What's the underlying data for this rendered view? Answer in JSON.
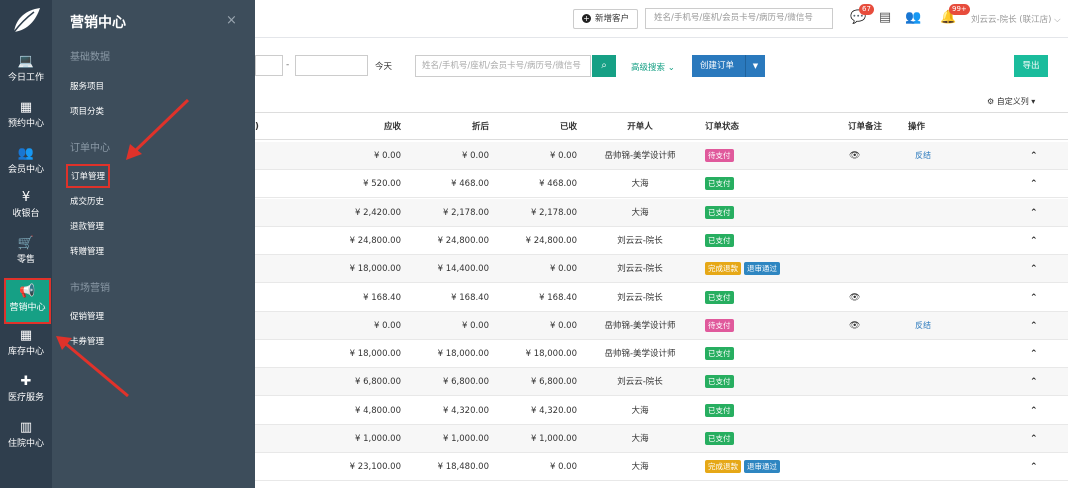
{
  "nav": [
    {
      "id": "today-work",
      "label": "今日工作",
      "icon": "laptop-icon",
      "glyph": "💻"
    },
    {
      "id": "appointment",
      "label": "预约中心",
      "icon": "calendar-icon",
      "glyph": "▦"
    },
    {
      "id": "member",
      "label": "会员中心",
      "icon": "users-icon",
      "glyph": "👥"
    },
    {
      "id": "cashier",
      "label": "收银台",
      "icon": "yen-icon",
      "glyph": "¥"
    },
    {
      "id": "retail",
      "label": "零售",
      "icon": "cart-icon",
      "glyph": "🛒"
    },
    {
      "id": "marketing",
      "label": "营销中心",
      "icon": "megaphone-icon",
      "glyph": "📢"
    },
    {
      "id": "inventory",
      "label": "库存中心",
      "icon": "grid-icon",
      "glyph": "▦"
    },
    {
      "id": "medical",
      "label": "医疗服务",
      "icon": "medkit-icon",
      "glyph": "✚"
    },
    {
      "id": "inpatient",
      "label": "住院中心",
      "icon": "building-icon",
      "glyph": "▥"
    }
  ],
  "panel": {
    "title": "营销中心",
    "close": "×",
    "groups": [
      {
        "heading": "基础数据",
        "items": [
          "服务项目",
          "项目分类"
        ]
      },
      {
        "heading": "订单中心",
        "items": [
          "订单管理",
          "成交历史",
          "退款管理",
          "转赠管理"
        ]
      },
      {
        "heading": "市场营销",
        "items": [
          "促销管理",
          "卡券管理"
        ]
      }
    ]
  },
  "topbar": {
    "add_customer": "新增客户",
    "search_placeholder": "姓名/手机号/座机/会员卡号/病历号/微信号",
    "badge_chat": "67",
    "badge_bell": "99+",
    "user": "刘云云-院长 (联江店)"
  },
  "toolbar": {
    "dash": "-",
    "today": "今天",
    "search_placeholder": "姓名/手机号/座机/会员卡号/病历号/微信号",
    "advanced": "高级搜索",
    "create": "创建订单",
    "export": "导出",
    "custom_columns": "自定义列"
  },
  "table": {
    "headers": {
      "frag": ")",
      "receivable": "应收",
      "discounted": "折后",
      "paid": "已收",
      "creator": "开单人",
      "status": "订单状态",
      "remark": "订单备注",
      "action": "操作"
    },
    "rows": [
      {
        "receivable": "¥ 0.00",
        "discounted": "¥ 0.00",
        "paid": "¥ 0.00",
        "creator": "岳帅锦-美学设计师",
        "tags": [
          {
            "text": "待支付",
            "color": "pink"
          }
        ],
        "eye": true,
        "action": "反结"
      },
      {
        "receivable": "¥ 520.00",
        "discounted": "¥ 468.00",
        "paid": "¥ 468.00",
        "creator": "大海",
        "tags": [
          {
            "text": "已支付",
            "color": "green"
          }
        ],
        "eye": false,
        "action": ""
      },
      {
        "receivable": "¥ 2,420.00",
        "discounted": "¥ 2,178.00",
        "paid": "¥ 2,178.00",
        "creator": "大海",
        "tags": [
          {
            "text": "已支付",
            "color": "green"
          }
        ],
        "eye": false,
        "action": ""
      },
      {
        "receivable": "¥ 24,800.00",
        "discounted": "¥ 24,800.00",
        "paid": "¥ 24,800.00",
        "creator": "刘云云-院长",
        "tags": [
          {
            "text": "已支付",
            "color": "green"
          }
        ],
        "eye": false,
        "action": ""
      },
      {
        "receivable": "¥ 18,000.00",
        "discounted": "¥ 14,400.00",
        "paid": "¥ 0.00",
        "creator": "刘云云-院长",
        "tags": [
          {
            "text": "完成退款",
            "color": "yellow"
          },
          {
            "text": "退审通过",
            "color": "blue"
          }
        ],
        "eye": false,
        "action": ""
      },
      {
        "receivable": "¥ 168.40",
        "discounted": "¥ 168.40",
        "paid": "¥ 168.40",
        "creator": "刘云云-院长",
        "tags": [
          {
            "text": "已支付",
            "color": "green"
          }
        ],
        "eye": true,
        "action": ""
      },
      {
        "receivable": "¥ 0.00",
        "discounted": "¥ 0.00",
        "paid": "¥ 0.00",
        "creator": "岳帅锦-美学设计师",
        "tags": [
          {
            "text": "待支付",
            "color": "pink"
          }
        ],
        "eye": true,
        "action": "反结"
      },
      {
        "receivable": "¥ 18,000.00",
        "discounted": "¥ 18,000.00",
        "paid": "¥ 18,000.00",
        "creator": "岳帅锦-美学设计师",
        "tags": [
          {
            "text": "已支付",
            "color": "green"
          }
        ],
        "eye": false,
        "action": ""
      },
      {
        "receivable": "¥ 6,800.00",
        "discounted": "¥ 6,800.00",
        "paid": "¥ 6,800.00",
        "creator": "刘云云-院长",
        "tags": [
          {
            "text": "已支付",
            "color": "green"
          }
        ],
        "eye": false,
        "action": ""
      },
      {
        "receivable": "¥ 4,800.00",
        "discounted": "¥ 4,320.00",
        "paid": "¥ 4,320.00",
        "creator": "大海",
        "tags": [
          {
            "text": "已支付",
            "color": "green"
          }
        ],
        "eye": false,
        "action": ""
      },
      {
        "receivable": "¥ 1,000.00",
        "discounted": "¥ 1,000.00",
        "paid": "¥ 1,000.00",
        "creator": "大海",
        "tags": [
          {
            "text": "已支付",
            "color": "green"
          }
        ],
        "eye": false,
        "action": ""
      },
      {
        "receivable": "¥ 23,100.00",
        "discounted": "¥ 18,480.00",
        "paid": "¥ 0.00",
        "creator": "大海",
        "tags": [
          {
            "text": "完成退款",
            "color": "yellow"
          },
          {
            "text": "退审通过",
            "color": "blue"
          }
        ],
        "eye": false,
        "action": ""
      }
    ]
  }
}
